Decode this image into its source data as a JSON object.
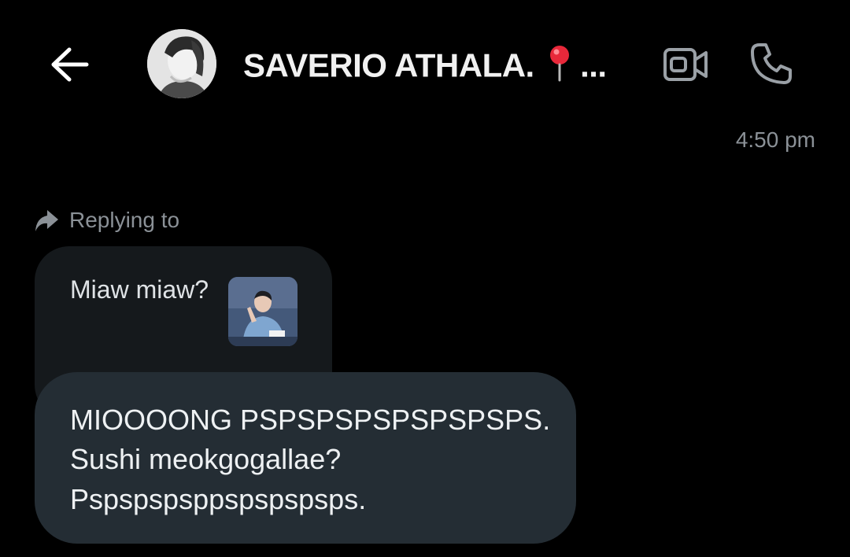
{
  "header": {
    "contact_name": "SAVERIO ATHALA.",
    "name_suffix": "...",
    "back_icon": "arrow-left-icon",
    "video_icon": "video-camera-icon",
    "call_icon": "phone-icon",
    "pin_icon": "round-pushpin-icon"
  },
  "conversation": {
    "timestamp": "4:50 pm",
    "reply_label": "Replying to",
    "quoted_message": {
      "text": "Miaw miaw?"
    },
    "message": {
      "lines": [
        "MIOOOONG PSPSPSPSPSPSPSPS.",
        "Sushi meokgogallae?",
        "Pspspspsppspspspsps."
      ]
    }
  },
  "colors": {
    "background": "#000000",
    "bubble_sent": "#242d34",
    "bubble_quoted": "#15191c",
    "muted_text": "#8b9197"
  }
}
